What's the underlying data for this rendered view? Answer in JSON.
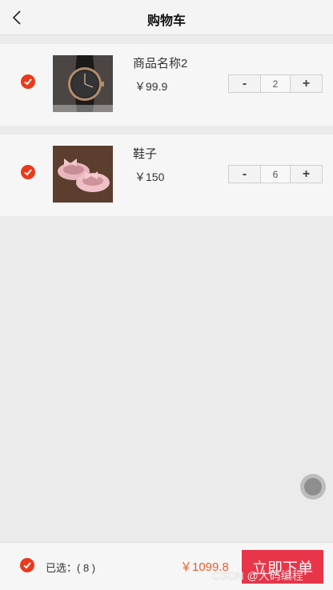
{
  "header": {
    "title": "购物车",
    "back_icon": "chevron-left-icon"
  },
  "cart": {
    "items": [
      {
        "name": "商品名称2",
        "price": "￥99.9",
        "quantity": "2",
        "minus_label": "-",
        "plus_label": "+",
        "selected": true,
        "image": "watch-image"
      },
      {
        "name": "鞋子",
        "price": "￥150",
        "quantity": "6",
        "minus_label": "-",
        "plus_label": "+",
        "selected": true,
        "image": "pink-shoes-image"
      }
    ]
  },
  "footer": {
    "selected_text": "已选：( 8 )",
    "total": "￥1099.8",
    "order_button": "立即下单",
    "all_selected": true
  },
  "watermark": "CSDN @大码编程",
  "colors": {
    "accent_red": "#ea3a1b",
    "order_button": "#e9354a",
    "total_price": "#ea5d2c",
    "background": "#ebebeb"
  }
}
